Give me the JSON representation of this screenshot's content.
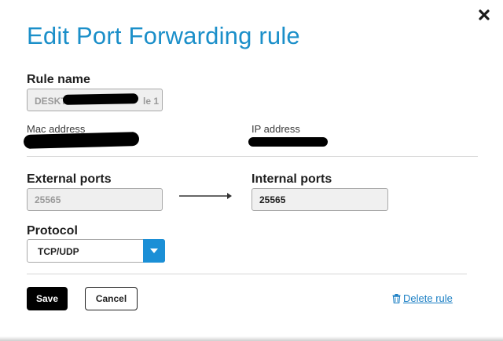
{
  "dialog": {
    "title": "Edit Port Forwarding rule",
    "close_icon": "close-icon"
  },
  "rule_name": {
    "label": "Rule name",
    "value_prefix": "DESKT",
    "value_suffix": "le 1"
  },
  "mac_address": {
    "label": "Mac address"
  },
  "ip_address": {
    "label": "IP address"
  },
  "external_ports": {
    "label": "External ports",
    "value": "25565"
  },
  "internal_ports": {
    "label": "Internal ports",
    "value": "25565"
  },
  "protocol": {
    "label": "Protocol",
    "value": "TCP/UDP",
    "toggle_icon": "chevron-down-icon"
  },
  "actions": {
    "save_label": "Save",
    "cancel_label": "Cancel",
    "delete_label": "Delete rule",
    "delete_icon": "trash-icon"
  },
  "colors": {
    "title": "#1b8fc9",
    "accent": "#1b8fd6",
    "link": "#1b7fc4"
  }
}
